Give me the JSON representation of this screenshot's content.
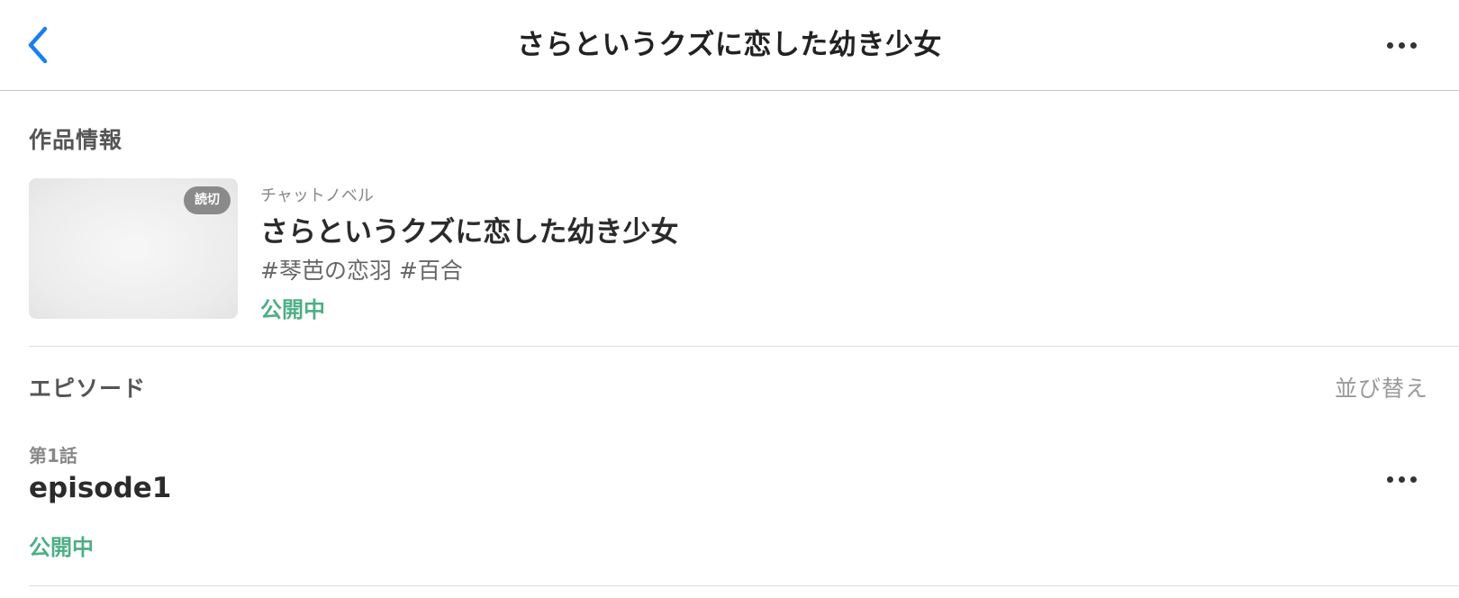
{
  "nav": {
    "back_icon": "chevron-left-icon",
    "title": "さらというクズに恋した幼き少女",
    "more_icon": "more-horizontal-icon"
  },
  "work_section": {
    "title": "作品情報",
    "badge": "読切",
    "genre": "チャットノベル",
    "work_title": "さらというクズに恋した幼き少女",
    "tags": "#琴芭の恋羽 #百合",
    "status": "公開中"
  },
  "episode_section": {
    "title": "エピソード",
    "sort_label": "並び替え",
    "episodes": [
      {
        "number": "第1話",
        "title": "episode1",
        "status": "公開中",
        "more_icon": "more-horizontal-icon"
      }
    ]
  },
  "colors": {
    "accent_blue": "#1a7ff2",
    "status_green": "#4caf84",
    "badge_gray": "#8a8a8a"
  }
}
